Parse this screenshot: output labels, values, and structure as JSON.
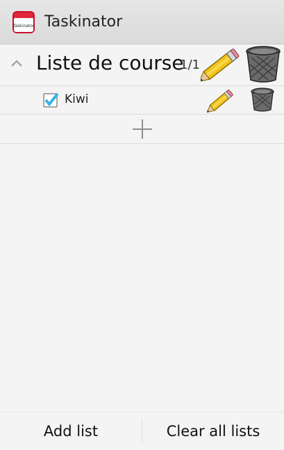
{
  "action_bar": {
    "title": "Taskinator",
    "app_icon_label": "Taskinator"
  },
  "list": {
    "title": "Liste de course",
    "count": "1/1",
    "collapse_icon": "chevron-up-icon",
    "edit_icon": "pencil-icon",
    "delete_icon": "trash-can-icon",
    "tasks": [
      {
        "label": "Kiwi",
        "checked": true
      }
    ],
    "add_icon": "plus-icon"
  },
  "bottom_bar": {
    "add_list": "Add list",
    "clear_all": "Clear all lists"
  },
  "colors": {
    "checkbox_accent": "#33b5e5",
    "pencil": "#f2c31a",
    "app_icon_red": "#c8102e"
  }
}
